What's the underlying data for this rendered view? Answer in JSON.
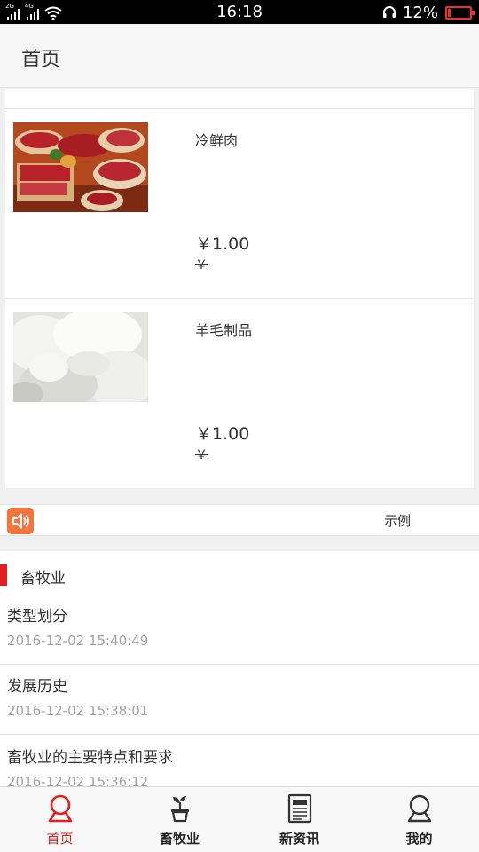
{
  "status_bar": {
    "sim1_label": "2G",
    "sim2_label": "4G",
    "time": "16:18",
    "battery_percent": "12%",
    "battery_level": 0.12,
    "battery_color": "#e8322a"
  },
  "header": {
    "title": "首页"
  },
  "products": [
    {
      "name": "冷鲜肉",
      "price": "￥1.00",
      "original_price": "￥",
      "image_icon": "raw-meat-photo"
    },
    {
      "name": "羊毛制品",
      "price": "￥1.00",
      "original_price": "￥",
      "image_icon": "wool-photo"
    }
  ],
  "notice": {
    "icon": "speaker-icon",
    "text": "示例",
    "icon_color": "#f2743f"
  },
  "news_section": {
    "title": "畜牧业",
    "accent_color": "#e02020",
    "items": [
      {
        "title": "类型划分",
        "time": "2016-12-02 15:40:49"
      },
      {
        "title": "发展历史",
        "time": "2016-12-02 15:38:01"
      },
      {
        "title": "畜牧业的主要特点和要求",
        "time": "2016-12-02 15:36:12"
      }
    ]
  },
  "tabbar": {
    "active_color": "#e02020",
    "tabs": [
      {
        "label": "首页",
        "icon": "home-person-icon",
        "active": true
      },
      {
        "label": "畜牧业",
        "icon": "plant-pot-icon",
        "active": false
      },
      {
        "label": "新资讯",
        "icon": "newspaper-icon",
        "active": false
      },
      {
        "label": "我的",
        "icon": "user-icon",
        "active": false
      }
    ]
  }
}
